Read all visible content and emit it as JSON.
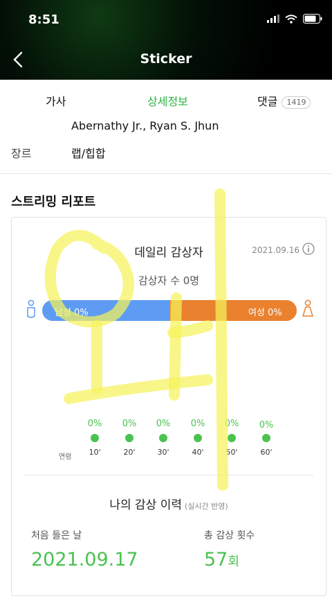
{
  "status_bar": {
    "time": "8:51"
  },
  "header": {
    "title": "Sticker"
  },
  "tabs": [
    {
      "label": "가사"
    },
    {
      "label": "상세정보"
    },
    {
      "label": "댓글",
      "count": "1419"
    }
  ],
  "info": {
    "artist_line": "Abernathy Jr., Ryan S. Jhun",
    "genre_label": "장르",
    "genre_value": "랩/힙합"
  },
  "report": {
    "title": "스트리밍 리포트",
    "daily_title": "데일리 감상자",
    "date": "2021.09.16",
    "listeners": "감상자 수 0명",
    "male": "남성 0%",
    "female": "여성 0%",
    "age_header": "연령",
    "ages": [
      {
        "pct": "0%",
        "label": "10'"
      },
      {
        "pct": "0%",
        "label": "20'"
      },
      {
        "pct": "0%",
        "label": "30'"
      },
      {
        "pct": "0%",
        "label": "40'"
      },
      {
        "pct": "0%",
        "label": "50'"
      },
      {
        "pct": "0%",
        "label": "60'"
      }
    ],
    "history_title": "나의 감상 이력",
    "history_note": "(실시간 반영)",
    "first_label": "처음 들은 날",
    "first_value": "2021.09.17",
    "total_label": "총 감상 횟수",
    "total_value": "57",
    "total_unit": "회"
  },
  "colors": {
    "accent": "#2fb342",
    "male": "#5d9cf2",
    "female": "#e9812f"
  }
}
